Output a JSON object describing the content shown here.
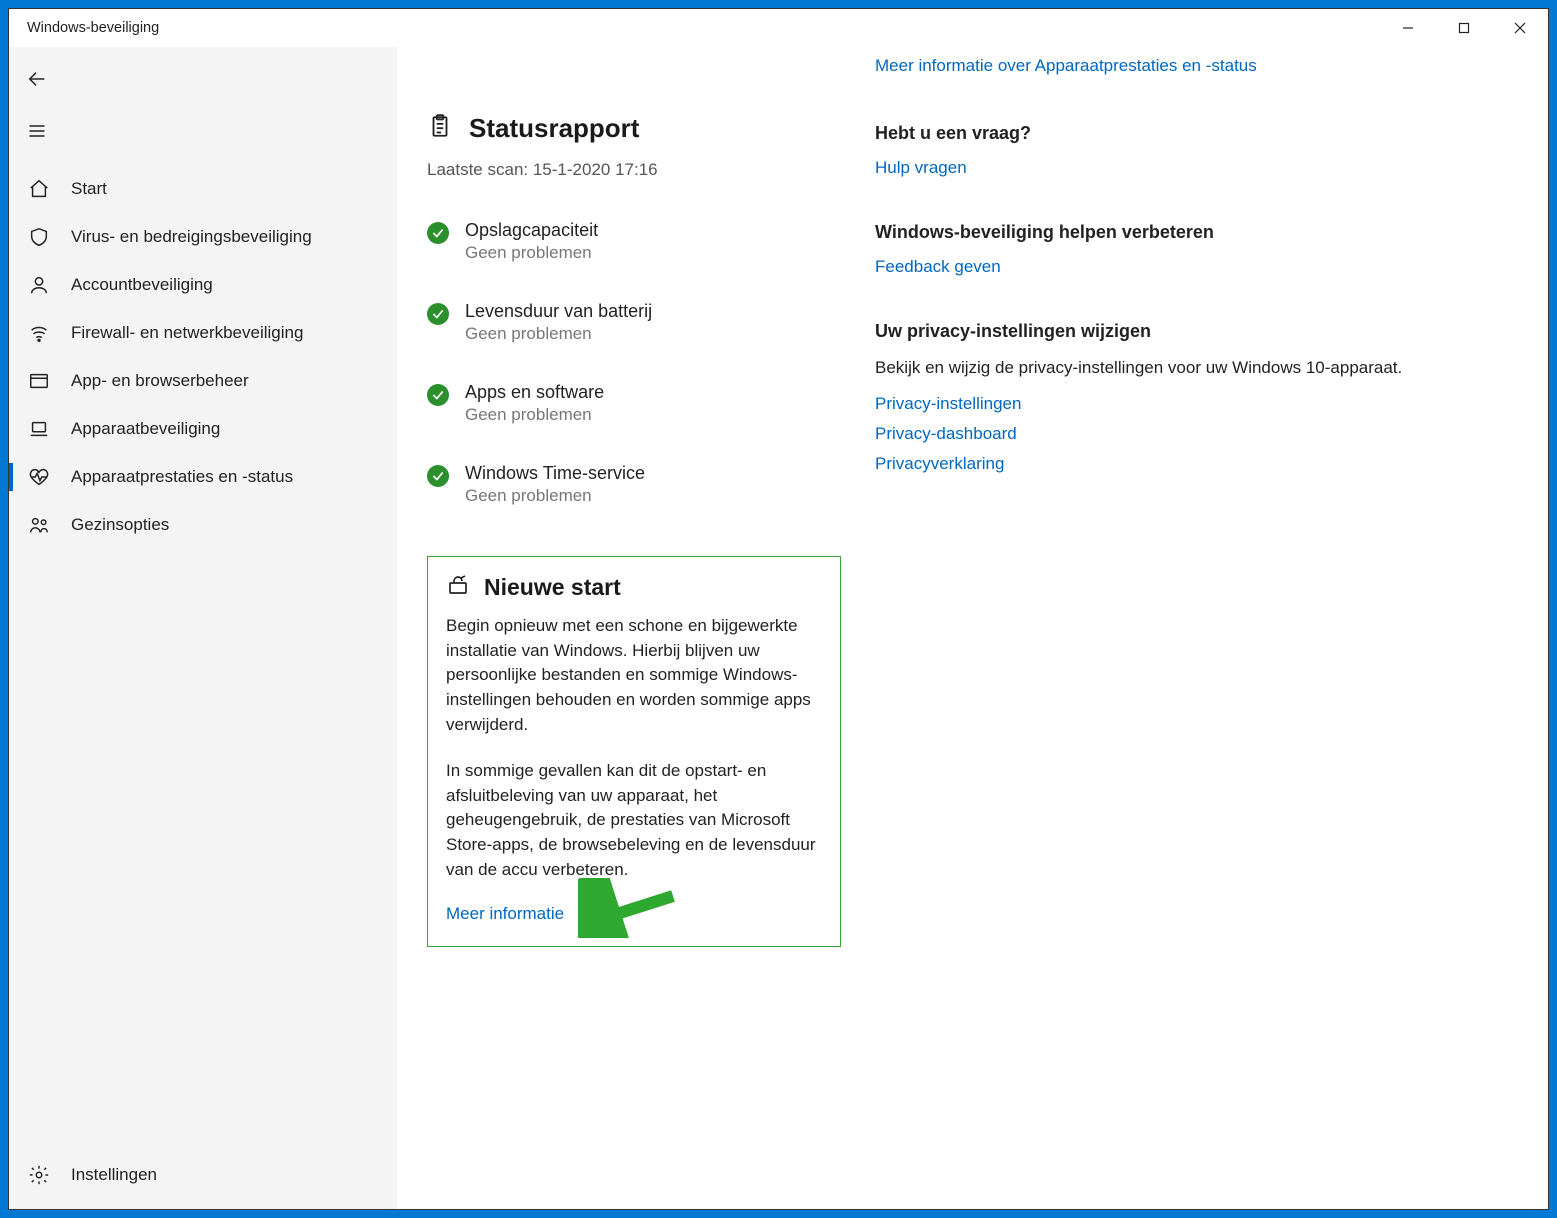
{
  "window": {
    "title": "Windows-beveiliging"
  },
  "sidebar": {
    "items": [
      {
        "label": "Start",
        "name": "sidebar-item-start"
      },
      {
        "label": "Virus- en bedreigingsbeveiliging",
        "name": "sidebar-item-virus"
      },
      {
        "label": "Accountbeveiliging",
        "name": "sidebar-item-account"
      },
      {
        "label": "Firewall- en netwerkbeveiliging",
        "name": "sidebar-item-firewall"
      },
      {
        "label": "App- en browserbeheer",
        "name": "sidebar-item-appbrowser"
      },
      {
        "label": "Apparaatbeveiliging",
        "name": "sidebar-item-device-security"
      },
      {
        "label": "Apparaatprestaties en -status",
        "name": "sidebar-item-device-perf"
      },
      {
        "label": "Gezinsopties",
        "name": "sidebar-item-family"
      }
    ],
    "settings": "Instellingen"
  },
  "main": {
    "status_heading": "Statusrapport",
    "last_scan": "Laatste scan: 15-1-2020 17:16",
    "status_items": [
      {
        "title": "Opslagcapaciteit",
        "sub": "Geen problemen"
      },
      {
        "title": "Levensduur van batterij",
        "sub": "Geen problemen"
      },
      {
        "title": "Apps en software",
        "sub": "Geen problemen"
      },
      {
        "title": "Windows Time-service",
        "sub": "Geen problemen"
      }
    ],
    "fresh": {
      "heading": "Nieuwe start",
      "p1": "Begin opnieuw met een schone en bijgewerkte installatie van Windows. Hierbij blijven uw persoonlijke bestanden en sommige Windows-instellingen behouden en worden sommige apps verwijderd.",
      "p2": "In sommige gevallen kan dit de opstart- en afsluitbeleving van uw apparaat, het geheugengebruik, de prestaties van Microsoft Store-apps, de browsebeleving en de levensduur van de accu verbeteren.",
      "link": "Meer informatie"
    }
  },
  "right": {
    "top_link": "Meer informatie over Apparaatprestaties en -status",
    "question": {
      "heading": "Hebt u een vraag?",
      "link": "Hulp vragen"
    },
    "improve": {
      "heading": "Windows-beveiliging helpen verbeteren",
      "link": "Feedback geven"
    },
    "privacy": {
      "heading": "Uw privacy-instellingen wijzigen",
      "para": "Bekijk en wijzig de privacy-instellingen voor uw Windows 10-apparaat.",
      "links": [
        "Privacy-instellingen",
        "Privacy-dashboard",
        "Privacyverklaring"
      ]
    }
  }
}
